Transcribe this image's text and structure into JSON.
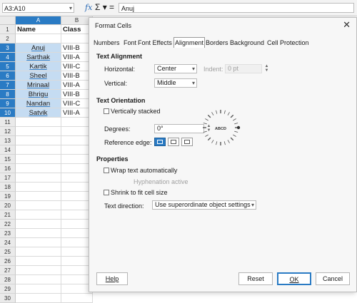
{
  "formula_bar": {
    "name_box": "A3:A10",
    "fx_icon": "fx-icon",
    "sigma_icon": "sigma-icon",
    "equals_icon": "equals-icon",
    "content": "Anuj"
  },
  "sheet": {
    "col_headers": [
      "A",
      "B"
    ],
    "row_headers": [
      "1",
      "2",
      "3",
      "4",
      "5",
      "6",
      "7",
      "8",
      "9",
      "10",
      "11",
      "12",
      "13",
      "14",
      "15",
      "16",
      "17",
      "18",
      "19",
      "20",
      "21",
      "22",
      "23",
      "24",
      "25",
      "26",
      "27",
      "28",
      "29",
      "30"
    ],
    "header_row": [
      "Name",
      "Class"
    ],
    "rows": [
      [
        "",
        ""
      ],
      [
        "Anuj",
        "VIII-B"
      ],
      [
        "Sarthak",
        "VIII-A"
      ],
      [
        "Kartik",
        "VIII-C"
      ],
      [
        "Sheel",
        "VIII-B"
      ],
      [
        "Mrinaal",
        "VIII-A"
      ],
      [
        "Bhrigu",
        "VIII-B"
      ],
      [
        "Nandan",
        "VIII-C"
      ],
      [
        "Satvik",
        "VIII-A"
      ]
    ]
  },
  "dialog": {
    "title": "Format Cells",
    "close": "✕",
    "tabs": [
      "Numbers",
      "Font",
      "Font Effects",
      "Alignment",
      "Borders",
      "Background",
      "Cell Protection"
    ],
    "active_tab": "Alignment",
    "text_alignment": {
      "heading": "Text Alignment",
      "horizontal_label": "Horizontal:",
      "horizontal_value": "Center",
      "indent_label": "Indent:",
      "indent_value": "0 pt",
      "vertical_label": "Vertical:",
      "vertical_value": "Middle"
    },
    "text_orientation": {
      "heading": "Text Orientation",
      "vertically_stacked": "Vertically stacked",
      "degrees_label": "Degrees:",
      "degrees_value": "0°",
      "reference_edge_label": "Reference edge:",
      "dial_text": "ABCD"
    },
    "properties": {
      "heading": "Properties",
      "wrap_text": "Wrap text automatically",
      "hyphenation": "Hyphenation active",
      "shrink": "Shrink to fit cell size",
      "text_direction_label": "Text direction:",
      "text_direction_value": "Use superordinate object settings"
    },
    "buttons": {
      "help": "Help",
      "reset": "Reset",
      "ok": "OK",
      "cancel": "Cancel"
    }
  },
  "colors": {
    "selection": "#2a7bc4",
    "selected_cell": "#c5dcf2"
  }
}
